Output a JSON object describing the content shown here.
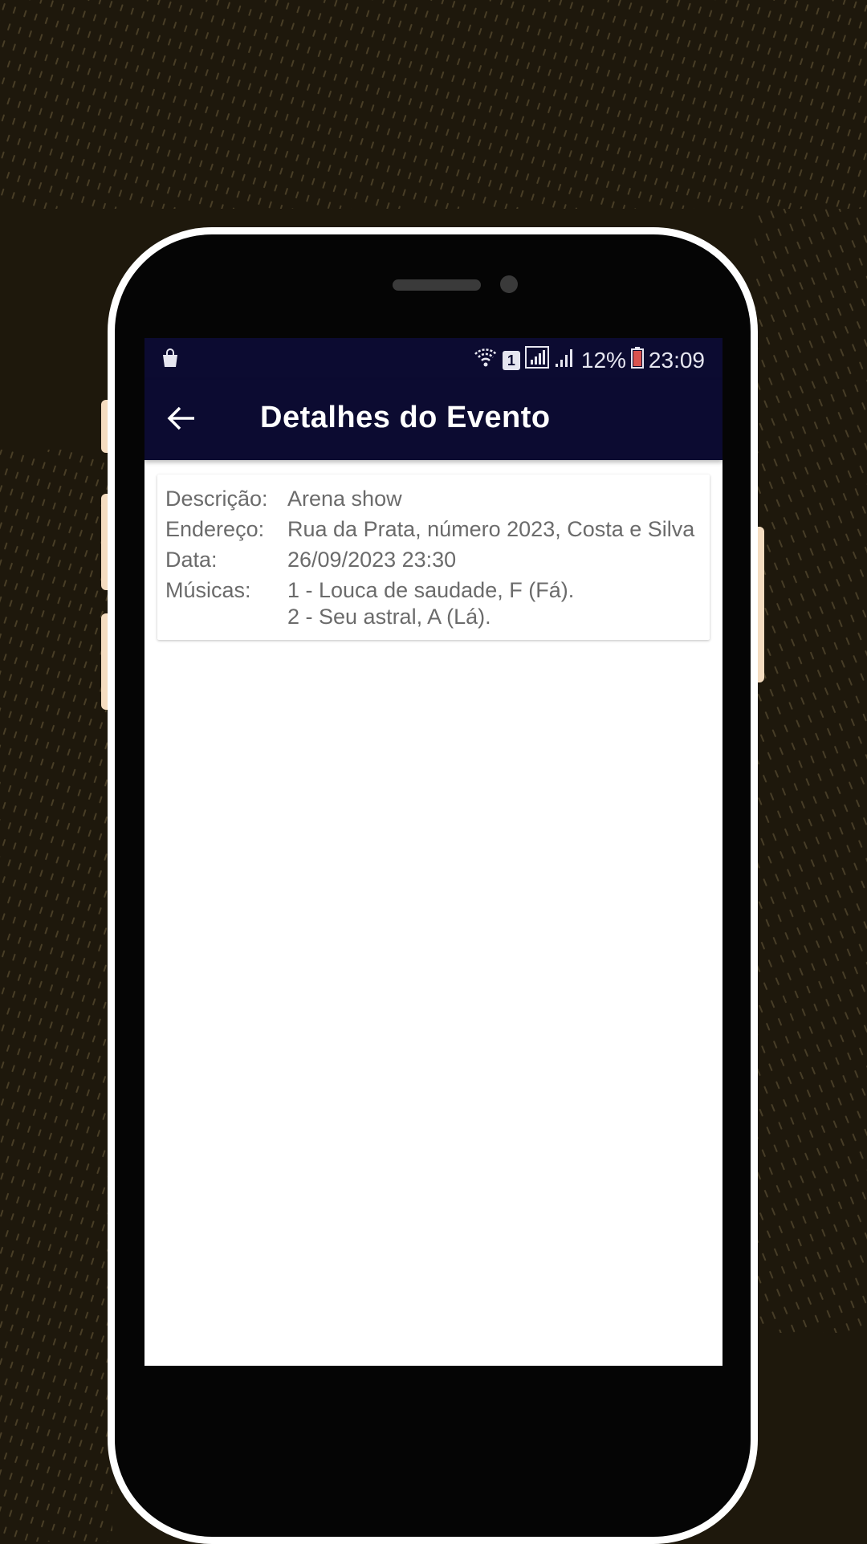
{
  "status_bar": {
    "battery": "12%",
    "time": "23:09",
    "sim": "1",
    "icons": [
      "shopping-bag-icon",
      "wifi-icon",
      "sim-icon",
      "signal-icon",
      "battery-icon"
    ]
  },
  "app_bar": {
    "title": "Detalhes do Evento",
    "back_icon": "arrow-left-icon"
  },
  "event": {
    "description_label": "Descrição:",
    "description": "Arena show",
    "address_label": "Endereço:",
    "address": "Rua da Prata, número 2023, Costa e Silva",
    "date_label": "Data:",
    "date": "26/09/2023 23:30",
    "songs_label": "Músicas:",
    "songs": [
      "1 - Louca de saudade, F (Fá).",
      "2 - Seu astral, A (Lá)."
    ]
  },
  "colors": {
    "app_bar": "#0c0b31",
    "background": "#1e180c",
    "frame": "#ffffff",
    "text": "#6b6b6b"
  }
}
